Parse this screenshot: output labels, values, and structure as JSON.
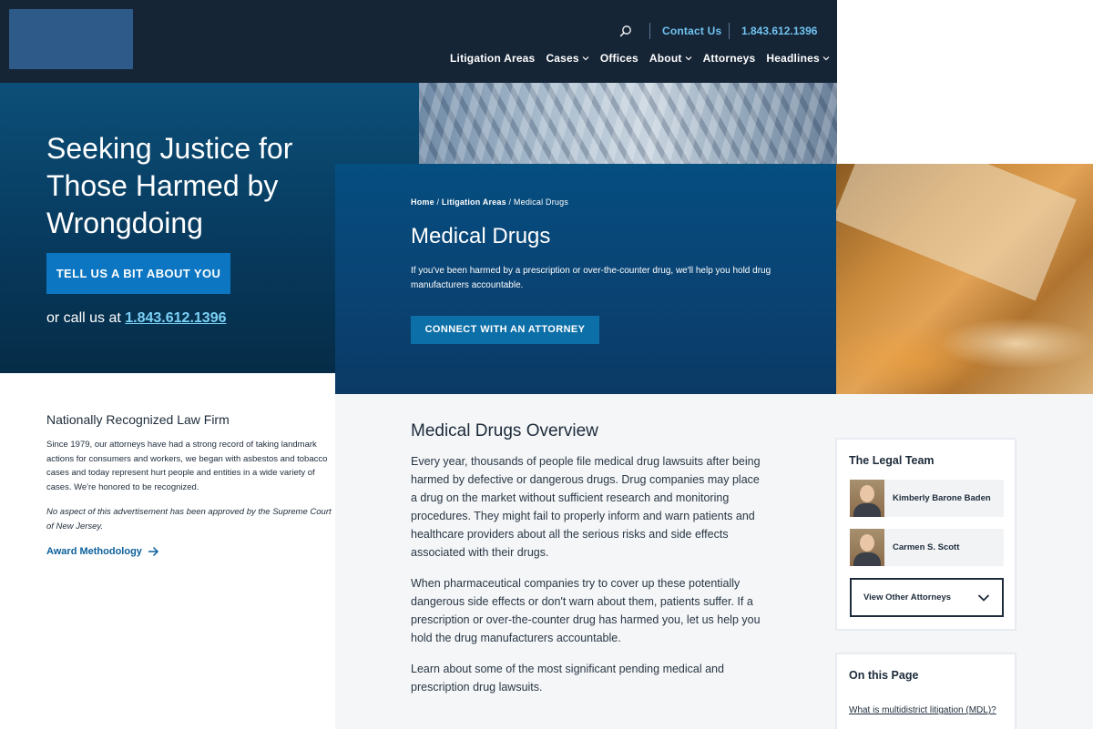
{
  "header": {
    "contact_label": "Contact Us",
    "phone": "1.843.612.1396",
    "nav": [
      {
        "label": "Litigation Areas",
        "has_menu": false
      },
      {
        "label": "Cases",
        "has_menu": true
      },
      {
        "label": "Offices",
        "has_menu": false
      },
      {
        "label": "About",
        "has_menu": true
      },
      {
        "label": "Attorneys",
        "has_menu": false
      },
      {
        "label": "Headlines",
        "has_menu": true
      }
    ]
  },
  "hero_left": {
    "title": "Seeking Justice for Those Harmed by Wrongdoing",
    "cta_label": "TELL US A BIT ABOUT YOU",
    "call_prefix": "or call us at",
    "call_phone": "1.843.612.1396"
  },
  "hero_main": {
    "breadcrumb": {
      "home": "Home",
      "litigation": "Litigation Areas",
      "current": "Medical Drugs"
    },
    "title": "Medical Drugs",
    "intro": "If you've been harmed by a prescription or over-the-counter drug, we'll help you hold drug manufacturers accountable.",
    "cta_label": "CONNECT WITH AN ATTORNEY"
  },
  "firm": {
    "heading": "Nationally Recognized Law Firm",
    "body": "Since 1979, our attorneys have had a strong record of taking landmark actions for consumers and workers, we began with asbestos and tobacco cases and today represent hurt people and entities in a wide variety of cases. We're honored to be recognized.",
    "disclaimer": "No aspect of this advertisement has been approved by the Supreme Court of New Jersey.",
    "award_link": "Award Methodology"
  },
  "overview": {
    "title": "Medical Drugs Overview",
    "paragraphs": [
      "Every year, thousands of people file medical drug lawsuits after being harmed by defective or dangerous drugs. Drug companies may place a drug on the market without sufficient research and monitoring procedures. They might fail to properly inform and warn patients and healthcare providers about all the serious risks and side effects associated with their drugs.",
      "When pharmaceutical companies try to cover up these potentially dangerous side effects or don't warn about them, patients suffer. If a prescription or over-the-counter drug has harmed you, let us help you hold the drug manufacturers accountable.",
      "Learn about some of the most significant pending medical and prescription drug lawsuits."
    ]
  },
  "legal_team": {
    "title": "The Legal Team",
    "attorneys": [
      {
        "name": "Kimberly Barone Baden"
      },
      {
        "name": "Carmen S. Scott"
      }
    ],
    "view_others_label": "View Other Attorneys"
  },
  "on_this_page": {
    "title": "On this Page",
    "links": [
      "What is multidistrict litigation (MDL)?"
    ]
  },
  "colors": {
    "header_bg": "#162536",
    "accent_link": "#6fc3f0",
    "primary_button": "#0c76c2",
    "hero_blue": "#054e80",
    "content_bg": "#f4f6f8"
  },
  "icons": {
    "search": "search-icon",
    "caret": "chevron-down-icon",
    "arrow": "arrow-right-icon"
  }
}
